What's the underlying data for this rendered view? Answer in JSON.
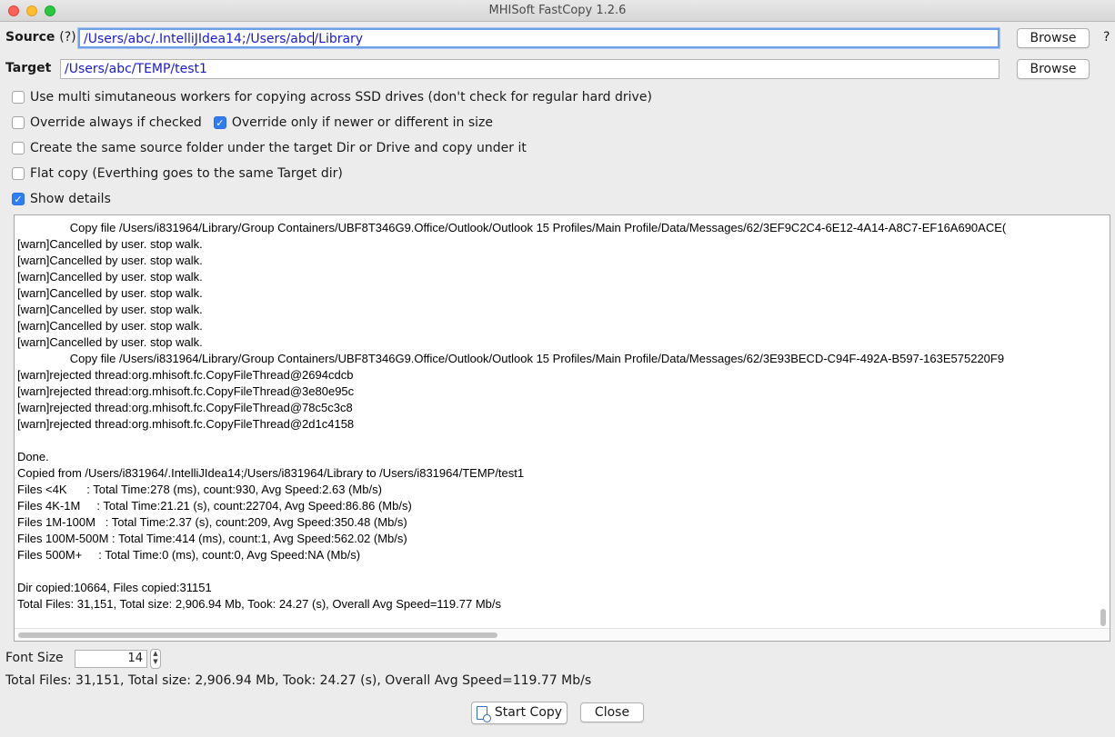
{
  "window": {
    "title": "MHISoft FastCopy 1.2.6"
  },
  "source": {
    "label": "Source",
    "help_link": "(?)",
    "value": "/Users/abc/.IntelliJIdea14;/Users/abc",
    "value_after_caret": "/Library",
    "browse_label": "Browse",
    "help_button": "?"
  },
  "target": {
    "label": "Target",
    "value": "/Users/abc/TEMP/test1",
    "browse_label": "Browse"
  },
  "options": {
    "multi_workers": {
      "label": "Use multi simutaneous workers for copying across SSD drives (don't check for regular hard drive)",
      "checked": false
    },
    "override_always": {
      "label": "Override always if checked",
      "checked": false
    },
    "override_newer": {
      "label": "Override only if newer or different in size",
      "checked": true
    },
    "create_source_folder": {
      "label": "Create the same source folder under the target Dir or Drive and copy under it",
      "checked": false
    },
    "flat_copy": {
      "label": "Flat copy (Everthing goes to the same Target dir)",
      "checked": false
    },
    "show_details": {
      "label": "Show details",
      "checked": true
    }
  },
  "log": {
    "lines": [
      "                Copy file /Users/i831964/Library/Group Containers/UBF8T346G9.Office/Outlook/Outlook 15 Profiles/Main Profile/Data/Messages/62/3EF9C2C4-6E12-4A14-A8C7-EF16A690ACE(",
      "[warn]Cancelled by user. stop walk.",
      "[warn]Cancelled by user. stop walk.",
      "[warn]Cancelled by user. stop walk.",
      "[warn]Cancelled by user. stop walk.",
      "[warn]Cancelled by user. stop walk.",
      "[warn]Cancelled by user. stop walk.",
      "[warn]Cancelled by user. stop walk.",
      "                Copy file /Users/i831964/Library/Group Containers/UBF8T346G9.Office/Outlook/Outlook 15 Profiles/Main Profile/Data/Messages/62/3E93BECD-C94F-492A-B597-163E575220F9",
      "[warn]rejected thread:org.mhisoft.fc.CopyFileThread@2694cdcb",
      "[warn]rejected thread:org.mhisoft.fc.CopyFileThread@3e80e95c",
      "[warn]rejected thread:org.mhisoft.fc.CopyFileThread@78c5c3c8",
      "[warn]rejected thread:org.mhisoft.fc.CopyFileThread@2d1c4158",
      "",
      "Done.",
      "Copied from /Users/i831964/.IntelliJIdea14;/Users/i831964/Library to /Users/i831964/TEMP/test1",
      "Files <4K      : Total Time:278 (ms), count:930, Avg Speed:2.63 (Mb/s)",
      "Files 4K-1M     : Total Time:21.21 (s), count:22704, Avg Speed:86.86 (Mb/s)",
      "Files 1M-100M   : Total Time:2.37 (s), count:209, Avg Speed:350.48 (Mb/s)",
      "Files 100M-500M : Total Time:414 (ms), count:1, Avg Speed:562.02 (Mb/s)",
      "Files 500M+     : Total Time:0 (ms), count:0, Avg Speed:NA (Mb/s)",
      "",
      "Dir copied:10664, Files copied:31151",
      "Total Files: 31,151, Total size: 2,906.94 Mb, Took: 24.27 (s), Overall Avg Speed=119.77 Mb/s"
    ]
  },
  "font_size": {
    "label": "Font Size",
    "value": "14"
  },
  "status_text": "Total Files: 31,151, Total size: 2,906.94 Mb, Took: 24.27 (s), Overall Avg Speed=119.77 Mb/s",
  "buttons": {
    "start_copy": "Start Copy",
    "close": "Close"
  },
  "colors": {
    "checkbox_accent": "#2f7cf6",
    "field_text": "#1a1ad0",
    "focus_ring": "#6fa0e6"
  }
}
